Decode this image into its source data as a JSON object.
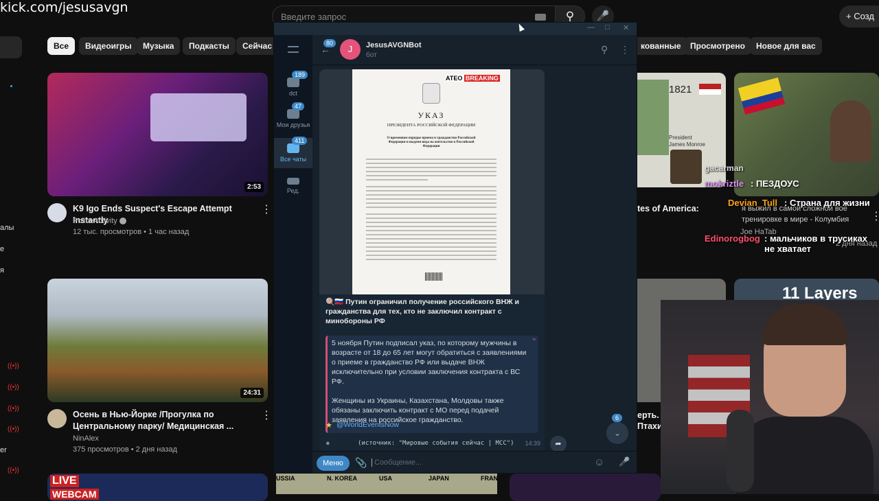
{
  "watermark": "kick.com/jesusavgn",
  "youtube": {
    "search_placeholder": "Введите запрос",
    "create_label": "+ Созд",
    "chips": [
      "Все",
      "Видеоигры",
      "Музыка",
      "Подкасты",
      "Сейчас в",
      "кованные",
      "Просмотрено",
      "Новое для вас"
    ],
    "sidebar_labels": [
      "алы",
      "е",
      "я",
      "er"
    ],
    "videos": [
      {
        "title": "K9 Igo Ends Suspect's Escape Attempt Instantly",
        "channel": "PoliceActivity",
        "meta": "12 тыс. просмотров • 1 час назад",
        "duration": "2:53"
      },
      {
        "title": "Осень в Нью-Йорке /Прогулка по Центральному парку/ Медицинская ...",
        "channel": "NinAlex",
        "meta": "375 просмотров • 2 дня назад",
        "duration": "24:31"
      }
    ],
    "right_thumbs": {
      "map_year": "1821",
      "map_president_label": "President",
      "map_president": "James Monroe",
      "title_fragment": "tes of America:",
      "second_title": "я выжил в самой сложной вое тренировке в мире - Колумбия",
      "second_channel": "Joe HaTab",
      "second_meta": "2 дня назад",
      "thumb_text": "11 Layers",
      "row_title_a": "ерть.",
      "row_title_b": "Птахи"
    },
    "bottom_strip": [
      "LIVE",
      "WEBCAM",
      "USSIA",
      "N. KOREA",
      "USA",
      "JAPAN",
      "FRAN"
    ]
  },
  "telegram": {
    "back_badge": "80",
    "bot_initial": "J",
    "bot_name": "JesusAVGNBot",
    "bot_subtitle": "бот",
    "folders": [
      {
        "label": "dct",
        "badge": "189"
      },
      {
        "label": "Мои друзья",
        "badge": "47"
      },
      {
        "label": "Все чаты",
        "badge": "411"
      },
      {
        "label": "Ред.",
        "badge": ""
      }
    ],
    "doc": {
      "tag_left": "ATEO",
      "tag_right": "BREAKING",
      "title": "УКАЗ",
      "subtitle": "ПРЕЗИДЕНТА РОССИЙСКОЙ ФЕДЕРАЦИИ",
      "heading": "О временном порядке приема в гражданство Российской Федерации и выдачи вида на жительство в Российской Федерации"
    },
    "headline": "🍭🇷🇺 Путин ограничил получение российского ВНЖ и гражданства для тех, кто не заключил контракт с минобороны РФ",
    "quote_p1": "5 ноября Путин подписал указ, по которому мужчины в возрасте от 18 до 65 лет могут обратиться с заявлениями о приеме в гражданство РФ или выдаче ВНЖ исключительно при условии заключения контракта с ВС РФ.",
    "quote_p2": "Женщины из Украины, Казахстана, Молдовы также обязаны заключить контракт с МО перед подачей заявления на российское гражданство.",
    "link": "@WorldEventsNow",
    "source": "(источник: \"Мировые события сейчас | MCC\")",
    "time": "14:39",
    "scroll_badge": "6",
    "menu_label": "Меню",
    "input_placeholder": "Сообщение..."
  },
  "chat": [
    {
      "user": "gacarman",
      "text": "ПЕЗДОУС",
      "user2": "mokriztle"
    },
    {
      "user": "Devian_Tull",
      "text": ": Страна для жизни"
    },
    {
      "user": "Edinorogbog",
      "text": ": мальчиков в трусиках не хватает"
    }
  ],
  "colors": {
    "yt_bg": "#0f0f0f",
    "tg_bg": "#17212b",
    "tg_accent": "#3f88c5",
    "quote_bar": "#d4506e"
  }
}
